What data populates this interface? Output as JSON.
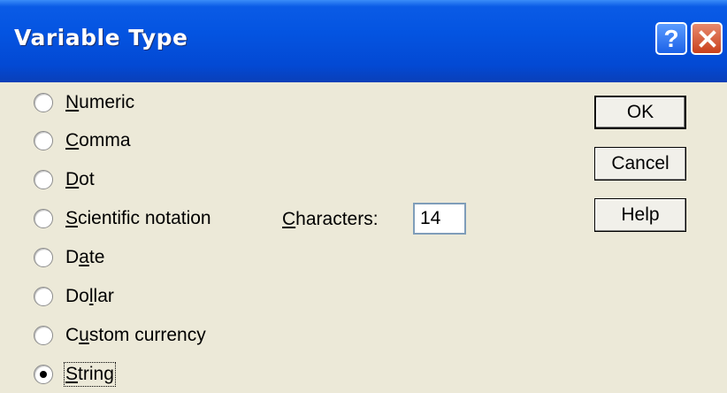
{
  "window": {
    "title": "Variable Type"
  },
  "titlebar": {
    "help_glyph": "?",
    "close_icon": "close-x-icon"
  },
  "types": [
    {
      "pre": "",
      "key": "N",
      "post": "umeric"
    },
    {
      "pre": "",
      "key": "C",
      "post": "omma"
    },
    {
      "pre": "",
      "key": "D",
      "post": "ot"
    },
    {
      "pre": "",
      "key": "S",
      "post": "cientific notation"
    },
    {
      "pre": "D",
      "key": "a",
      "post": "te"
    },
    {
      "pre": "Do",
      "key": "l",
      "post": "lar"
    },
    {
      "pre": "C",
      "key": "u",
      "post": "stom currency"
    },
    {
      "pre": "",
      "key": "S",
      "post": "tring"
    }
  ],
  "selected_type": "String",
  "characters": {
    "key": "C",
    "post": "haracters:",
    "value": "14"
  },
  "buttons": {
    "ok": "OK",
    "cancel": "Cancel",
    "help": "Help"
  }
}
